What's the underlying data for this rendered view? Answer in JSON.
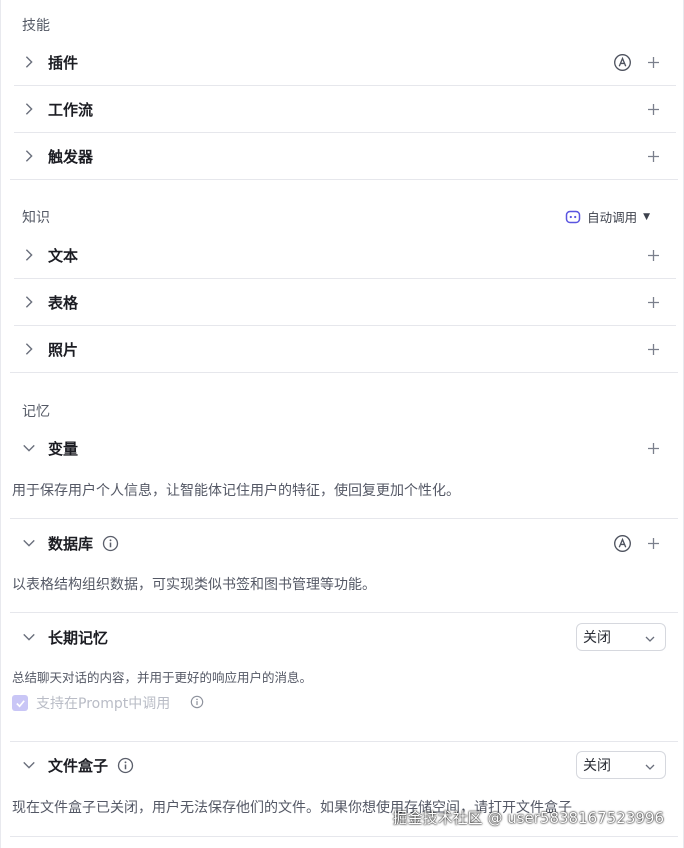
{
  "skills": {
    "title": "技能",
    "items": [
      {
        "label": "插件"
      },
      {
        "label": "工作流"
      },
      {
        "label": "触发器"
      }
    ]
  },
  "knowledge": {
    "title": "知识",
    "invoke_mode": "自动调用",
    "items": [
      {
        "label": "文本"
      },
      {
        "label": "表格"
      },
      {
        "label": "照片"
      }
    ]
  },
  "memory": {
    "title": "记忆",
    "variables": {
      "label": "变量",
      "desc": "用于保存用户个人信息，让智能体记住用户的特征，使回复更加个性化。"
    },
    "database": {
      "label": "数据库",
      "desc": "以表格结构组织数据，可实现类似书签和图书管理等功能。"
    },
    "long_term": {
      "label": "长期记忆",
      "select_value": "关闭",
      "desc": "总结聊天对话的内容，并用于更好的响应用户的消息。",
      "checkbox_label": "支持在Prompt中调用"
    },
    "file_box": {
      "label": "文件盒子",
      "select_value": "关闭",
      "desc": "现在文件盒子已关闭，用户无法保存他们的文件。如果你想使用存储空间，请打开文件盒子"
    }
  },
  "watermark": "掘金技术社区 @ user5838167523996",
  "colors": {
    "accent": "#5a55e0",
    "checkbox_fill": "#c9c6f6"
  },
  "icons": {
    "expand": "chevron-right-icon",
    "collapse": "chevron-down-icon",
    "add": "plus-icon",
    "auto": "auto-a-icon",
    "info": "info-icon",
    "bot": "bot-icon"
  }
}
